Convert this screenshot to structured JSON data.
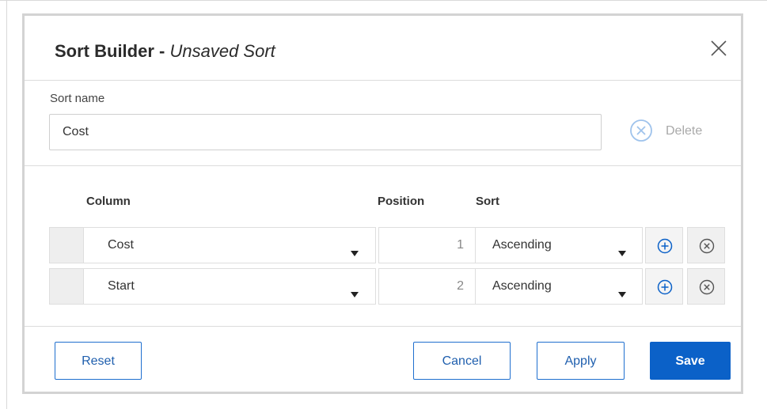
{
  "dialog": {
    "title": "Sort Builder -",
    "subtitle": "Unsaved Sort",
    "close_icon": "close-icon"
  },
  "sort_name": {
    "label": "Sort name",
    "value": "Cost",
    "delete_label": "Delete",
    "delete_icon": "circle-x-icon"
  },
  "table": {
    "headers": {
      "column": "Column",
      "position": "Position",
      "sort": "Sort"
    },
    "rows": [
      {
        "column": "Cost",
        "position": "1",
        "sort": "Ascending"
      },
      {
        "column": "Start",
        "position": "2",
        "sort": "Ascending"
      }
    ],
    "add_icon": "circle-plus-icon",
    "remove_icon": "circle-x-icon"
  },
  "footer": {
    "reset_label": "Reset",
    "cancel_label": "Cancel",
    "apply_label": "Apply",
    "save_label": "Save"
  },
  "colors": {
    "accent": "#0b61c8",
    "disabled_icon": "#9fc3ec",
    "border": "#d3d3d3"
  }
}
